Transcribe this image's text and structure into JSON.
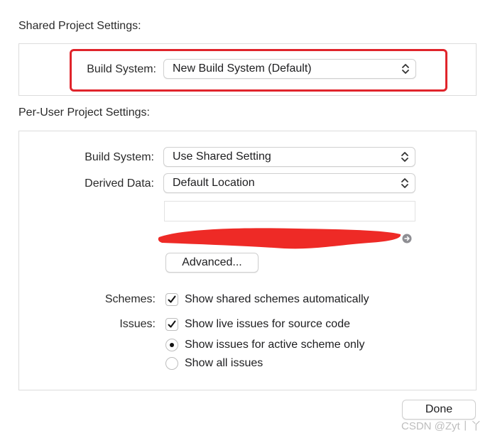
{
  "shared": {
    "title": "Shared Project Settings:",
    "build_system_label": "Build System:",
    "build_system_value": "New Build System (Default)"
  },
  "per_user": {
    "title": "Per-User Project Settings:",
    "build_system_label": "Build System:",
    "build_system_value": "Use Shared Setting",
    "derived_data_label": "Derived Data:",
    "derived_data_value": "Default Location",
    "path_field_value": "",
    "advanced_button": "Advanced...",
    "schemes_label": "Schemes:",
    "schemes_option": "Show shared schemes automatically",
    "schemes_checked": true,
    "issues_label": "Issues:",
    "issues_live_option": "Show live issues for source code",
    "issues_live_checked": true,
    "issues_active_scheme_option": "Show issues for active scheme only",
    "issues_all_option": "Show all issues",
    "issues_selected": "active_scheme"
  },
  "footer": {
    "done_button": "Done",
    "watermark": "CSDN @Zyt丨丫"
  },
  "colors": {
    "highlight": "#e0242b",
    "redaction": "#ee2a26"
  },
  "icons": {
    "popup_chevron": "chevron-up-down-icon",
    "reveal_arrow": "arrow-circle-right-icon",
    "checkmark": "checkmark-icon"
  }
}
